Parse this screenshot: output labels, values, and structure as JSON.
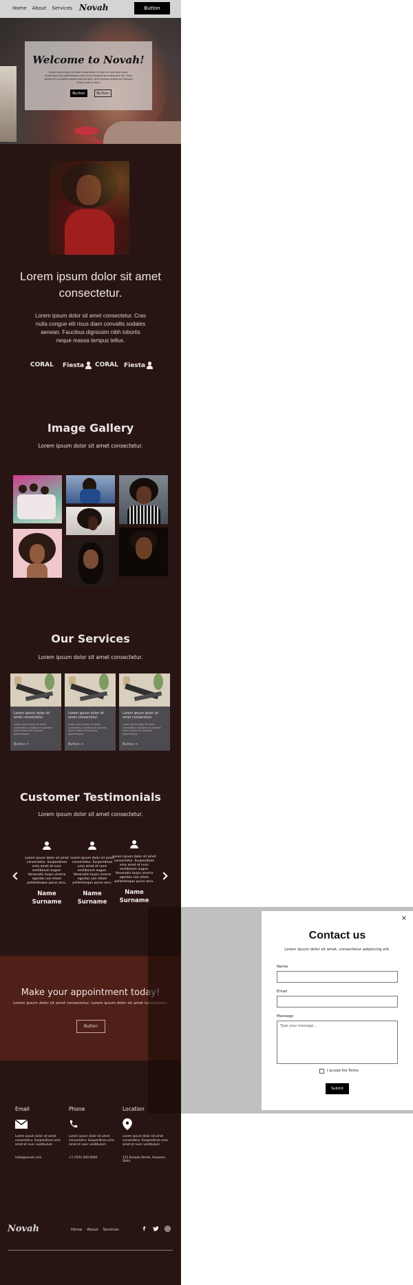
{
  "nav": {
    "links": [
      "Home",
      "About",
      "Services"
    ],
    "logo": "Novah",
    "button": "Button"
  },
  "hero": {
    "title": "Welcome to Novah!",
    "text": "Lorem ipsum dolor sit amet consectetur. Et sem leo nam diam arcu. Scelerisque sed pellentesque enim lacus volutpat leo vestibulum dui. Proin aliquet et in gravida massa vehicula duis. Velit pretium sagittis sed tempus amet morbi in risus.",
    "button_primary": "Button",
    "button_secondary": "Button"
  },
  "about": {
    "title": "Lorem ipsum dolor sit amet consectetur.",
    "text": "Lorem ipsum dolor sit amet consectetur. Cras nulla congue elit risus diam convallis sodales aenean. Faucibus dignissim nibh lobortis neque massa tempus tellus.",
    "logos": [
      "CORAL",
      "Fiesta",
      "CORAL",
      "Fiesta"
    ]
  },
  "gallery": {
    "title": "Image Gallery",
    "subtitle": "Lorem ipsum dolor sit amet consectetur."
  },
  "services": {
    "title": "Our Services",
    "subtitle": "Lorem ipsum dolor sit amet consectetur.",
    "cards": [
      {
        "title": "Lorem ipsum dolor sit amet consectetur.",
        "text": "Lorem ipsum dolor sit amet consectetur. Vestibulum placerat quam neque orci tempus pellentesque.",
        "link": "Button >"
      },
      {
        "title": "Lorem ipsum dolor sit amet consectetur.",
        "text": "Lorem ipsum dolor sit amet consectetur. Vestibulum placerat quam neque orci tempus pellentesque.",
        "link": "Button >"
      },
      {
        "title": "Lorem ipsum dolor sit amet consectetur.",
        "text": "Lorem ipsum dolor sit amet consectetur. Vestibulum placerat quam neque orci tempus pellentesque.",
        "link": "Button >"
      }
    ]
  },
  "testimonials": {
    "title": "Customer Testimonials",
    "subtitle": "Lorem ipsum dolor sit amet consectetur.",
    "items": [
      {
        "text": "Lorem ipsum dolor sit amet consectetur. Suspendisse urna amet et nunc vestibulum augue. Venenatis turpis viverra egestas non etiam pellentesque purus arcu.",
        "name": "Name Surname"
      },
      {
        "text": "Lorem ipsum dolor sit amet consectetur. Suspendisse urna amet et nunc vestibulum augue. Venenatis turpis viverra egestas non etiam pellentesque purus arcu.",
        "name": "Name Surname"
      },
      {
        "text": "Lorem ipsum dolor sit amet consectetur. Suspendisse urna amet et nunc vestibulum augue. Venenatis turpis viverra egestas non etiam pellentesque purus arcu.",
        "name": "Name Surname"
      }
    ]
  },
  "appointment": {
    "title": "Make your appointment today!",
    "text": "Lorem ipsum dolor sit amet consectetur. Lorem ipsum dolor sit amet consectetur.",
    "button": "Button"
  },
  "contact_info": [
    {
      "label": "Email",
      "icon": "envelope-icon",
      "text": "Lorem ipsum dolor sit amet consectetur. Suspendisse urna amet et nunc vestibulum",
      "value": "hello@novah.com"
    },
    {
      "label": "Phone",
      "icon": "phone-icon",
      "text": "Lorem ipsum dolor sit amet consectetur. Suspendisse urna amet et nunc vestibulum",
      "value": "+1 (555) 000-0000"
    },
    {
      "label": "Location",
      "icon": "location-pin-icon",
      "text": "Lorem ipsum dolor sit amet consectetur. Suspendisse urna amet et nunc vestibulum",
      "value": "123 Sample Street, Anytown, State"
    }
  ],
  "footer": {
    "logo": "Novah",
    "links": [
      "Home",
      "About",
      "Services"
    ],
    "social": [
      "facebook-icon",
      "twitter-icon",
      "instagram-icon"
    ]
  },
  "modal": {
    "title": "Contact us",
    "subtitle": "Lorem ipsum dolor sit amet, consectetur adipiscing elit.",
    "name_label": "Name",
    "email_label": "Email",
    "message_label": "Message",
    "message_placeholder": "Type your message...",
    "checkbox_label": "I accept the Terms",
    "submit": "Submit",
    "close": "×"
  },
  "colors": {
    "page_bg": "#281513",
    "appointment_bg": "#4f2017",
    "card_bg": "#4d4a50",
    "overlay": "#c0c0c0"
  }
}
